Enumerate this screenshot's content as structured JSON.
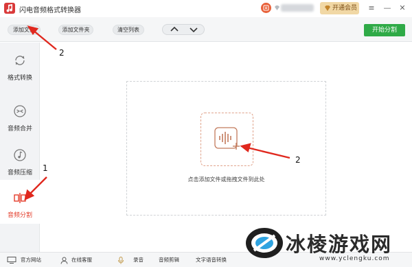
{
  "app": {
    "title": "闪电音频格式转换器"
  },
  "account": {
    "vip_label": "开通会员"
  },
  "window_controls": {
    "menu": "≡",
    "minimize": "—",
    "close": "✕"
  },
  "toolbar": {
    "add_file": "添加文件",
    "add_folder": "添加文件夹",
    "clear_list": "清空列表",
    "start": "开始分割"
  },
  "sidebar": {
    "items": [
      {
        "label": "格式转换",
        "icon": "refresh-icon"
      },
      {
        "label": "音频合并",
        "icon": "merge-icon"
      },
      {
        "label": "音频压缩",
        "icon": "music-note-icon"
      },
      {
        "label": "音频分割",
        "icon": "split-icon",
        "active": true
      }
    ]
  },
  "main": {
    "hint": "点击添加文件或拖拽文件到此处"
  },
  "statusbar": {
    "items": [
      "官方网站",
      "在线客服",
      "录音",
      "音频剪辑",
      "文字语音转换"
    ]
  },
  "annotations": {
    "n1": "1",
    "n2a": "2",
    "n2b": "2"
  },
  "watermark": {
    "text": "冰棱游戏网",
    "url": "www.yclengku.com"
  },
  "colors": {
    "accent": "#e33d2b",
    "start_button": "#2faa47",
    "vip": "#f1d8a5"
  }
}
